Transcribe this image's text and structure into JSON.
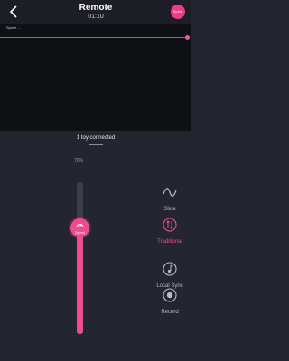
{
  "header": {
    "title": "Remote",
    "timer": "01:10",
    "avatar_label": "Spiral"
  },
  "waveform": {
    "label": "Spinel ..."
  },
  "panel": {
    "connected_text": "1 toy connected",
    "intensity_label": "70%",
    "intensity_level": 70,
    "slider_label": "Spinel"
  },
  "modes": [
    {
      "label": "Slide",
      "icon": "wave-icon",
      "active": false
    },
    {
      "label": "Traditional",
      "icon": "updown-arrows-icon",
      "active": true
    },
    {
      "label": "Local Sync",
      "icon": "music-sync-icon",
      "active": false
    },
    {
      "label": "Record",
      "icon": "record-icon",
      "active": false
    }
  ],
  "colors": {
    "accent": "#ef4b91",
    "background": "#23252f",
    "wave_background": "#0f1014"
  }
}
